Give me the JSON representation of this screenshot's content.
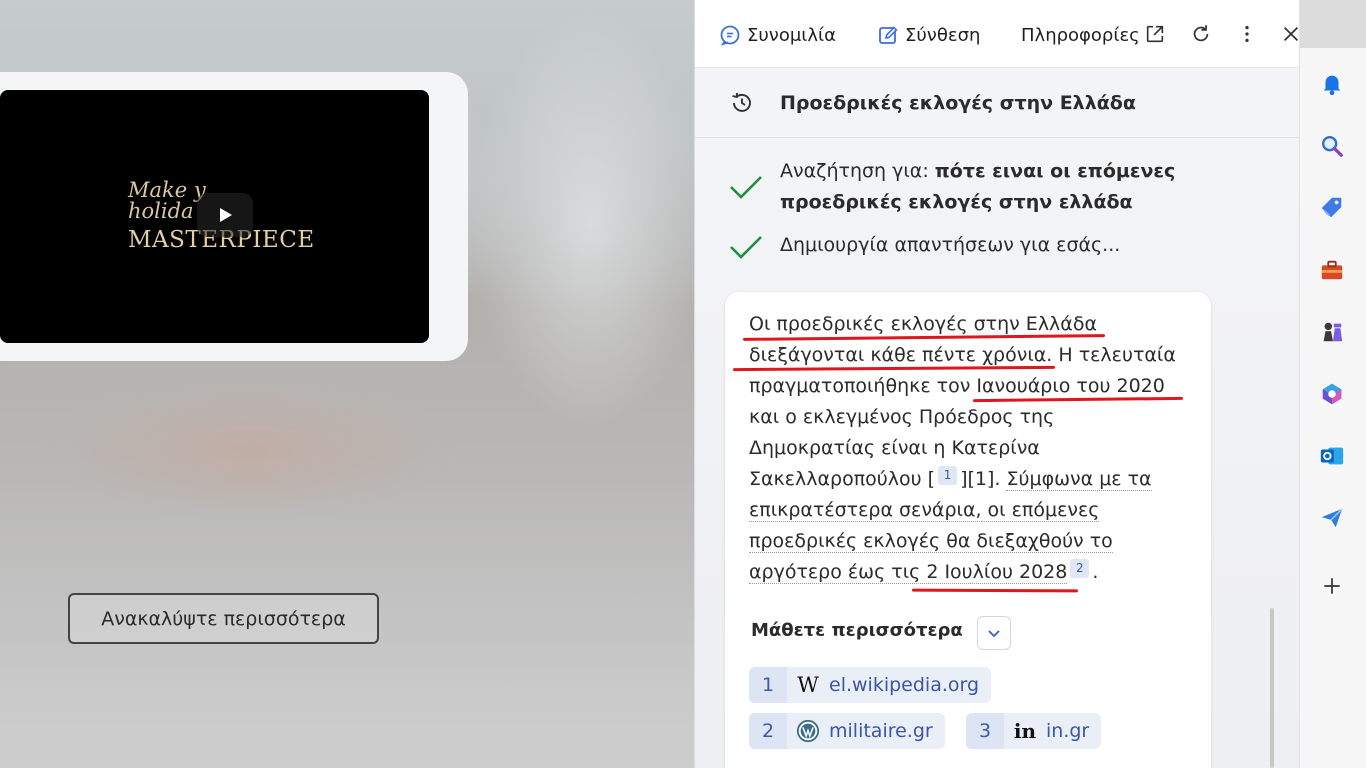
{
  "background_page": {
    "video": {
      "title_line1": "Make y",
      "title_line2": "holida",
      "title_line3": "MASTERPIECE"
    },
    "discover_button": "Ανακαλύψτε περισσότερα"
  },
  "panel": {
    "tabs": [
      {
        "label": "Συνομιλία",
        "icon": "chat-icon"
      },
      {
        "label": "Σύνθεση",
        "icon": "compose-icon"
      },
      {
        "label": "Πληροφορίες",
        "icon": "insights"
      }
    ],
    "top_actions": [
      "open-external-icon",
      "refresh-icon",
      "more-icon",
      "close-icon"
    ],
    "history_title": "Προεδρικές εκλογές στην Ελλάδα",
    "status": {
      "search_prefix": "Αναζήτηση για: ",
      "search_query_line1": "πότε ειναι οι επόμενες",
      "search_query_line2": "προεδρικές εκλογές στην ελλάδα",
      "generating": "Δημιουργία απαντήσεων για εσάς..."
    },
    "answer": {
      "l1": "Οι προεδρικές εκλογές στην Ελλάδα",
      "l2a": "διεξάγονται κάθε πέντε χρόνια.",
      "l2b": " Η τελευταία",
      "l3a": "πραγματοποιήθηκε τον ",
      "l3b": "Ιανουάριο του 2020",
      "l4": "και ο εκλεγμένος Πρόεδρος της",
      "l5": "Δημοκρατίας είναι η Κατερίνα",
      "l6a": "Σακελλαροπούλου [",
      "cite1": "1",
      "l6b": "][1]. ",
      "l6c": "Σύμφωνα με τα",
      "l7a": "επικρατέστερα σενάρια,",
      "l7b": " οι επόμενες",
      "l8": "προεδρικές εκλογές θα διεξαχθούν το",
      "l9a": "αργότερο έως τις 2 Ιουλίου 2028",
      "cite2": "2",
      "l9b": "."
    },
    "learn_more": "Μάθετε περισσότερα",
    "sources": [
      {
        "num": "1",
        "domain": "el.wikipedia.org",
        "icon": "wikipedia-icon"
      },
      {
        "num": "2",
        "domain": "militaire.gr",
        "icon": "wordpress-icon"
      },
      {
        "num": "3",
        "domain": "in.gr",
        "icon": "in-logo-icon"
      }
    ]
  },
  "edge_sidebar": {
    "icons": [
      "bell-icon",
      "search-icon",
      "tag-icon",
      "toolbox-icon",
      "chess-icon",
      "microsoft365-icon",
      "outlook-icon",
      "send-icon",
      "add-icon"
    ]
  },
  "colors": {
    "accent_blue": "#3a56a4",
    "check_green": "#1e8f3e",
    "underline_red": "#e0161e"
  }
}
